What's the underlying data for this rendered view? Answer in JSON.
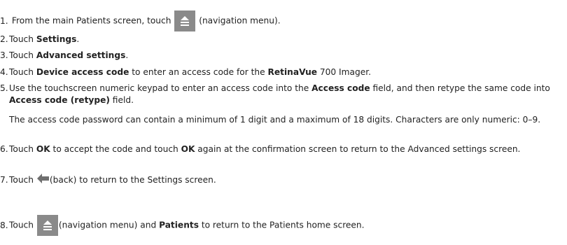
{
  "steps": [
    {
      "num": "1.",
      "pre": "From the main Patients screen, touch",
      "post": "(navigation menu)."
    },
    {
      "num": "2.",
      "pre": "Touch ",
      "bold": "Settings",
      "post": "."
    },
    {
      "num": "3.",
      "pre": "Touch ",
      "bold": "Advanced settings",
      "post": "."
    },
    {
      "num": "4.",
      "pre": "Touch ",
      "bold": "Device access code",
      "mid": " to enter an access code for the ",
      "bold2": "RetinaVue",
      "post": " 700 Imager."
    },
    {
      "num": "5.",
      "pre": "Use the touchscreen numeric keypad to enter an access code into the ",
      "bold": "Access code",
      "mid": " field, and then retype the same code into ",
      "bold2": "Access code (retype)",
      "post": " field."
    },
    {
      "num": "6.",
      "pre": "Touch ",
      "bold": "OK",
      "mid": " to accept the code and touch ",
      "bold2": "OK",
      "post": " again at the confirmation screen to return to the Advanced settings screen."
    },
    {
      "num": "7.",
      "pre": "Touch",
      "post": "(back) to return to the Settings screen."
    },
    {
      "num": "8.",
      "pre": "Touch",
      "mid": "(navigation menu) and ",
      "bold": "Patients",
      "post": " to return to the Patients home screen."
    }
  ],
  "note": "The access code password can contain a minimum of 1 digit and a maximum of 18 digits. Characters are only numeric: 0–9.",
  "icons": {
    "nav_menu": "navigation-menu-icon",
    "back": "back-arrow-icon",
    "nav_button_color": "#8a8a8a",
    "back_color": "#6f6f6f"
  }
}
